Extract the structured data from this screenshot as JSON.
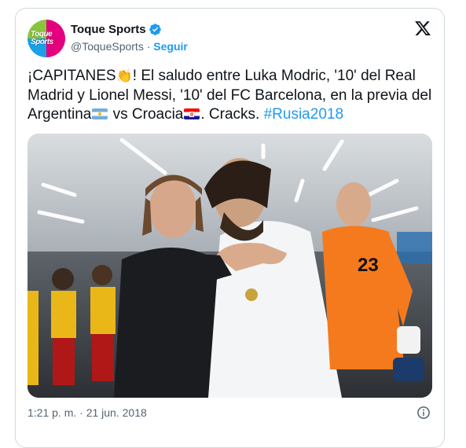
{
  "tweet": {
    "author": {
      "display_name": "Toque Sports",
      "handle": "@ToqueSports",
      "avatar_text": "Toque Sports",
      "verified": true
    },
    "separator": "·",
    "follow_label": "Seguir",
    "platform_icon": "x-logo-icon",
    "text": {
      "part1": "¡CAPITANES",
      "emoji1": "👏",
      "part2": "! El saludo entre Luka Modric, '10' del Real Madrid y Lionel Messi, '10' del FC Barcelona, en la previa del Argentina",
      "part3": " vs Croacia",
      "part4": ". Cracks. ",
      "hashtag": "#Rusia2018"
    },
    "photo": {
      "jersey_number": "23"
    },
    "timestamp": "1:21 p. m. · 21 jun. 2018",
    "colors": {
      "accent": "#1d9bf0",
      "text": "#0f1419",
      "muted": "#536471",
      "border": "#cfd9de"
    }
  }
}
